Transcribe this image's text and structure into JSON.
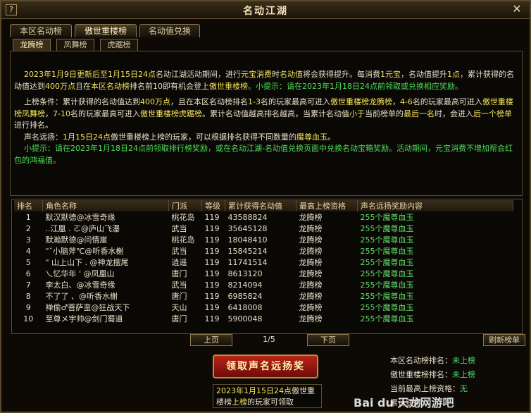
{
  "window": {
    "title": "名动江湖",
    "help": "?",
    "close": "✕"
  },
  "tabs": [
    "本区名动榜",
    "傲世重楼榜",
    "名动值兑换"
  ],
  "subtabs": [
    "龙腾榜",
    "凤舞榜",
    "虎踞榜"
  ],
  "info": {
    "p1_a": "2023年1月9日更新后至1月15日24点",
    "p1_b": "名动江湖活动期间，进行",
    "p1_c": "元宝消费",
    "p1_d": "时",
    "p1_e": "名动值",
    "p1_f": "将会获得提升。每消费",
    "p1_g": "1元宝",
    "p1_h": "，名动值提升",
    "p1_i": "1点",
    "p1_j": "，",
    "p1_k": "累计获得的名动值达到",
    "p1_l": "400万点",
    "p1_m": "且在",
    "p1_n": "本区名动榜",
    "p1_o": "排名前10",
    "p1_p": "即有机会登上",
    "p1_q": "傲世重楼榜",
    "p1_r": "。小提示：请在2023年1月18日24点前领取或兑换相应奖励。",
    "p2_a": "上榜条件：",
    "p2_b": "累计获得的名动值达到",
    "p2_c": "400万点",
    "p2_d": "，且在本区名动榜排名",
    "p2_e": "1-3",
    "p2_f": "名的玩家最高可进入",
    "p2_g": "傲世重楼榜龙腾榜",
    "p2_h": "，",
    "p2_i": "4-6",
    "p2_j": "名的玩家最高可进入",
    "p2_k": "傲世重楼榜凤舞榜",
    "p2_l": "，",
    "p2_m": "7-10",
    "p2_n": "名的玩家最高可进入",
    "p2_o": "傲世重楼榜虎踞榜",
    "p2_p": "。累计名动值越高排名越高，当累计名动值",
    "p2_q": "小于",
    "p2_r": "当前榜单的",
    "p2_s": "最后一名",
    "p2_t": "时，会进入",
    "p2_u": "后一个榜单",
    "p2_v": "进行排名。",
    "p3_a": "声名远扬：",
    "p3_b": "1月15日24点",
    "p3_c": "傲世重楼榜上榜的玩家，可以根据排名获得不同数量的",
    "p3_d": "魔尊血玉",
    "p3_e": "。",
    "p4": "小提示：请在2023年1月18日24点前领取排行榜奖励，或在名动江湖-名动值兑换页面中兑换名动宝箱奖励。活动期间，元宝消费不增加帮会红包的鸿福值。"
  },
  "table": {
    "headers": [
      "排名",
      "角色名称",
      "门派",
      "等级",
      "累计获得名动值",
      "最高上榜资格",
      "声名远扬奖励内容"
    ],
    "rows": [
      [
        "1",
        "默汉默德@冰雪奇缘",
        "桃花岛",
        "119",
        "43588824",
        "龙腾榜",
        "255个魔尊血玉"
      ],
      [
        "2",
        "..江凰 . ㄛ@庐山飞瀑",
        "武当",
        "119",
        "35645128",
        "龙腾榜",
        "255个魔尊血玉"
      ],
      [
        "3",
        "默瀚默德@问情崖",
        "桃花岛",
        "119",
        "18048410",
        "龙腾榜",
        "255个魔尊血玉"
      ],
      [
        "4",
        "\"ˇ小脑斧℃@听香水榭",
        "武当",
        "119",
        "15845214",
        "龙腾榜",
        "255个魔尊血玉"
      ],
      [
        "5",
        "\" 山上山下 . @神龙摆尾",
        "逍遥",
        "119",
        "11741514",
        "龙腾榜",
        "255个魔尊血玉"
      ],
      [
        "6",
        "乀忆华年 ' @凤凰山",
        "唐门",
        "119",
        "8613120",
        "龙腾榜",
        "255个魔尊血玉"
      ],
      [
        "7",
        "李太白、@冰雪奇缘",
        "武当",
        "119",
        "8214094",
        "龙腾榜",
        "255个魔尊血玉"
      ],
      [
        "8",
        "不了了 、@听香水榭",
        "唐门",
        "119",
        "6985824",
        "龙腾榜",
        "255个魔尊血玉"
      ],
      [
        "9",
        "禅偷♂菩萨蛮@狂战天下",
        "天山",
        "119",
        "6418008",
        "龙腾榜",
        "255个魔尊血玉"
      ],
      [
        "10",
        "至尊メ宇帅@剑门蜀道",
        "唐门",
        "119",
        "5900048",
        "龙腾榜",
        "255个魔尊血玉"
      ]
    ]
  },
  "pager": {
    "prev": "上页",
    "info": "1/5",
    "next": "下页",
    "refresh": "刷新榜单"
  },
  "claim_button": "领取声名远扬奖",
  "note": {
    "a": "2023年1月15日24点",
    "b": "傲世重",
    "c": "楼榜",
    "d": "上榜",
    "e": "的玩家可领取"
  },
  "stats": {
    "local_label": "本区名动榜排名：",
    "local_value": "未上榜",
    "aoshi_label": "傲世重楼榜排名：",
    "aoshi_value": "未上榜",
    "best_label": "当前最高上榜资格：",
    "best_value": "无",
    "extra_label": "累计获得"
  },
  "watermark": "Bai du 天龙网游吧"
}
